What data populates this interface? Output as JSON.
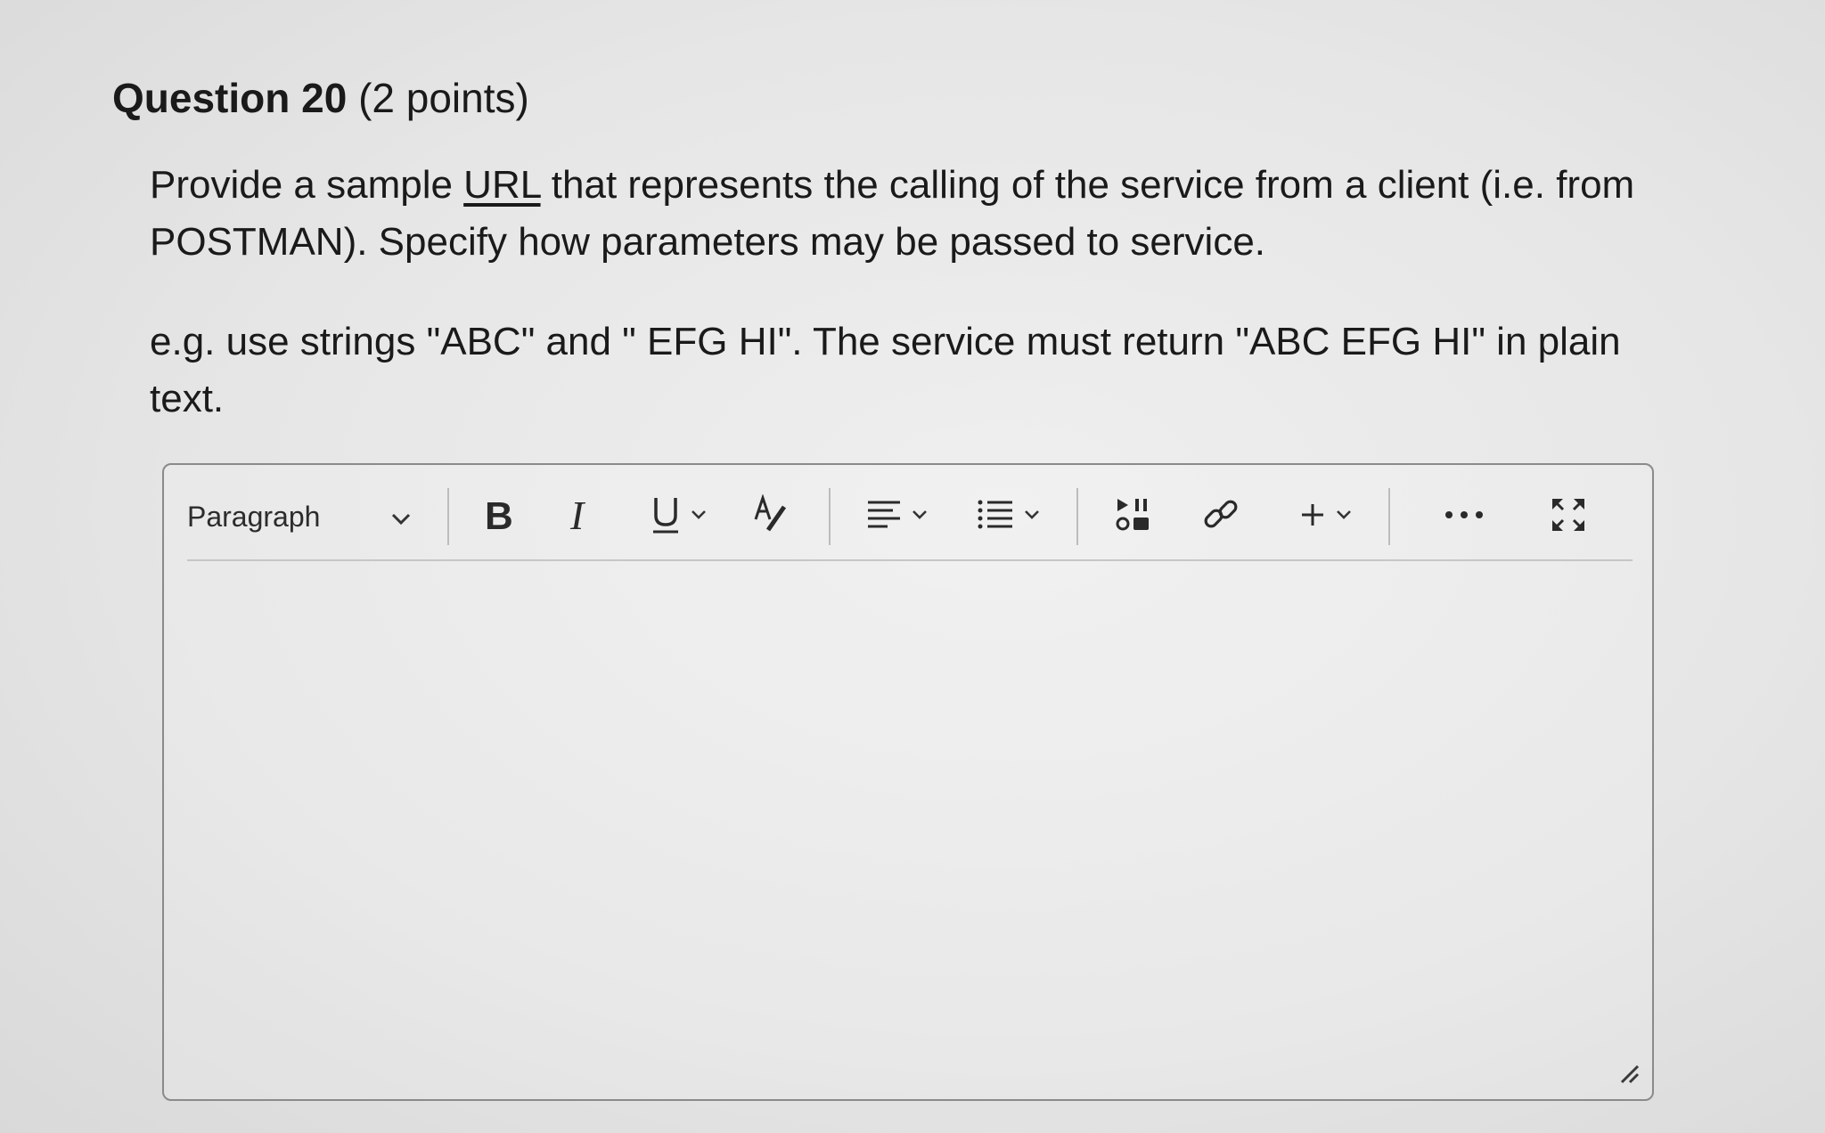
{
  "question": {
    "title_number": "Question 20",
    "title_points": " (2 points)",
    "line1_pre": "Provide a sample ",
    "line1_link": "URL",
    "line1_post": " that represents the calling of the service from a client (i.e. from POSTMAN). Specify how parameters may be passed to service.",
    "line2": "e.g. use strings \"ABC\" and \" EFG HI\". The service must return \"ABC EFG HI\" in plain text."
  },
  "editor": {
    "format_select": "Paragraph",
    "icons": [
      "chevron-down-icon",
      "bold-icon",
      "italic-icon",
      "underline-icon",
      "text-color-icon",
      "align-icon",
      "list-icon",
      "media-icon",
      "link-icon",
      "plus-icon",
      "more-icon",
      "fullscreen-icon",
      "resize-grip-icon"
    ],
    "body_text": ""
  }
}
